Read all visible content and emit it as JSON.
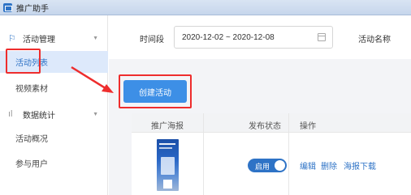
{
  "window": {
    "title": "推广助手"
  },
  "sidebar": {
    "groups": [
      {
        "label": "活动管理",
        "icon": "flag-icon"
      },
      {
        "label": "数据统计",
        "icon": "bar-chart-icon"
      }
    ],
    "items": [
      {
        "label": "活动列表",
        "active": true
      },
      {
        "label": "视频素材"
      },
      {
        "label": "活动概况"
      },
      {
        "label": "参与用户"
      }
    ]
  },
  "filter": {
    "date_label": "时间段",
    "date_range": "2020-12-02 ~ 2020-12-08",
    "name_label": "活动名称"
  },
  "toolbar": {
    "create_label": "创建活动"
  },
  "table": {
    "headers": [
      "推广海报",
      "发布状态",
      "操作"
    ],
    "rows": [
      {
        "status_label": "启用",
        "status_on": true,
        "actions": [
          "编辑",
          "删除",
          "海报下载"
        ]
      }
    ]
  },
  "colors": {
    "accent": "#2e73c6",
    "button": "#3d8fe6",
    "highlight": "#ee2d2d"
  }
}
